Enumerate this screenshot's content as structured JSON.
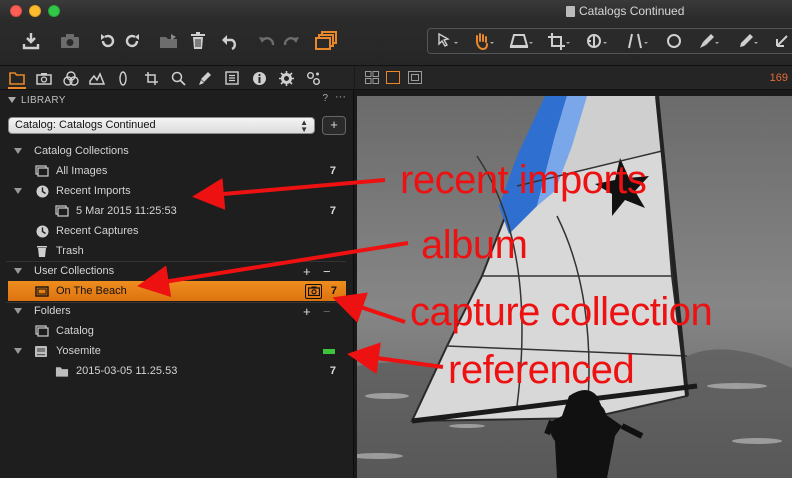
{
  "window": {
    "title": "Catalogs Continued"
  },
  "toolbar": {
    "left_icons": [
      "import-icon",
      "camera-icon",
      "rotate-left-icon",
      "rotate-right-icon",
      "move-to-folder-icon",
      "trash-icon",
      "reset-icon",
      "undo-icon",
      "redo-icon",
      "variants-icon"
    ],
    "cursor_tools": [
      "select-cursor-icon",
      "pan-hand-icon",
      "keystone-icon",
      "crop-icon",
      "rotate-tool-icon",
      "straighten-icon",
      "circle-mask-icon",
      "brush-icon",
      "picker-icon",
      "arrow-icon"
    ],
    "active_color": "#e8882a"
  },
  "tool_tabs": [
    "library-tab",
    "capture-tab",
    "color-tab",
    "exposure-tab",
    "lens-tab",
    "composition-tab",
    "details-tab",
    "local-adjustments-tab",
    "adjustments-tab",
    "metadata-tab",
    "output-tab",
    "batch-tab"
  ],
  "library": {
    "header": "LIBRARY",
    "help": "?",
    "menu": "···",
    "catalog_select": "Catalog: Catalogs Continued",
    "add_label": "+",
    "catalog_collections": {
      "label": "Catalog Collections",
      "all_images": {
        "label": "All Images",
        "count": "7"
      },
      "recent_imports": {
        "label": "Recent Imports"
      },
      "import_item": {
        "label": "5 Mar 2015 11:25:53",
        "count": "7"
      },
      "recent_captures": {
        "label": "Recent Captures"
      },
      "trash": {
        "label": "Trash"
      }
    },
    "user_collections": {
      "label": "User Collections",
      "add": "+",
      "remove": "−",
      "on_the_beach": {
        "label": "On The Beach",
        "count": "7"
      }
    },
    "folders": {
      "label": "Folders",
      "add": "+",
      "remove": "−",
      "catalog": {
        "label": "Catalog"
      },
      "yosemite": {
        "label": "Yosemite",
        "status_color": "#3cc43c"
      },
      "subfolder": {
        "label": "2015-03-05 11.25.53",
        "count": "7"
      }
    }
  },
  "viewer": {
    "image_count": "169"
  },
  "annotations": [
    {
      "text": "recent imports",
      "color": "#e11111"
    },
    {
      "text": "album",
      "color": "#e11111"
    },
    {
      "text": "capture collection",
      "color": "#e11111"
    },
    {
      "text": "referenced",
      "color": "#e11111"
    }
  ]
}
